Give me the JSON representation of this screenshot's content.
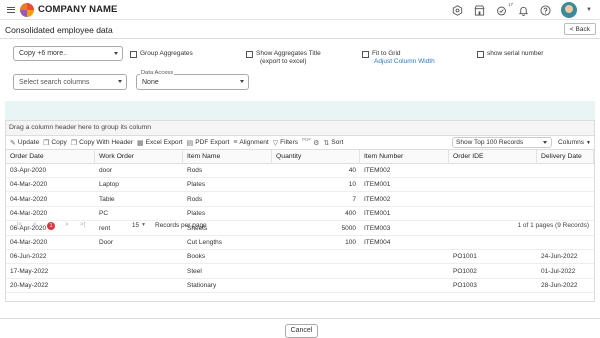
{
  "header": {
    "brand": "COMPANY NAME",
    "notif_count": "17"
  },
  "page": {
    "title": "Consolidated employee data",
    "back_label": "Back"
  },
  "controls": {
    "copy_select": "Copy  +6 more..",
    "group_aggregates": "Group Aggregates",
    "show_agg_title": "Show Aggregates Title",
    "show_agg_title_sub": "(export to excel)",
    "fit_to_grid": "Fit to Grid",
    "adjust_column_width": "Adjust Column Width",
    "show_serial": "show serial number",
    "search_columns_placeholder": "Select search columns",
    "data_access_label": "Data Access",
    "data_access_value": "None"
  },
  "grid": {
    "group_hint": "Drag a column header here to group its column",
    "toolbar": {
      "update": "Update",
      "copy": "Copy",
      "copy_header": "Copy With Header",
      "excel": "Excel Export",
      "pdf": "PDF Export",
      "alignment": "Alignment",
      "filters": "Filters",
      "pdf_small": "PDF",
      "sort": "Sort",
      "records_select": "Show Top 100 Records",
      "columns": "Columns"
    },
    "columns": [
      "Order Date",
      "Work Order",
      "Item Name",
      "Quantity",
      "Item Number",
      "Order IDE",
      "Delivery Date"
    ],
    "rows": [
      [
        "03-Apr-2020",
        "door",
        "Rods",
        "40",
        "ITEM002",
        "",
        ""
      ],
      [
        "04-Mar-2020",
        "Laptop",
        "Plates",
        "10",
        "ITEM001",
        "",
        ""
      ],
      [
        "04-Mar-2020",
        "Table",
        "Rods",
        "7",
        "ITEM002",
        "",
        ""
      ],
      [
        "04-Mar-2020",
        "PC",
        "Plates",
        "400",
        "ITEM001",
        "",
        ""
      ],
      [
        "06-Apr-2020",
        "rent",
        "Sheets",
        "5000",
        "ITEM003",
        "",
        ""
      ],
      [
        "04-Mar-2020",
        "Door",
        "Cut Lengths",
        "100",
        "ITEM004",
        "",
        ""
      ],
      [
        "06-Jun-2022",
        "",
        "Books",
        "",
        "",
        "PO1001",
        "24-Jun-2022"
      ],
      [
        "17-May-2022",
        "",
        "Steel",
        "",
        "",
        "PO1002",
        "01-Jul-2022"
      ],
      [
        "20-May-2022",
        "",
        "Stationary",
        "",
        "",
        "PO1003",
        "28-Jun-2022"
      ]
    ]
  },
  "pager": {
    "first": "|<",
    "prev": "<",
    "current": "1",
    "next": ">",
    "last": ">|",
    "page_size": "15",
    "page_size_label": "Records per page",
    "info": "1 of 1 pages (9 Records)"
  },
  "footer": {
    "cancel_label": "Cancel"
  }
}
